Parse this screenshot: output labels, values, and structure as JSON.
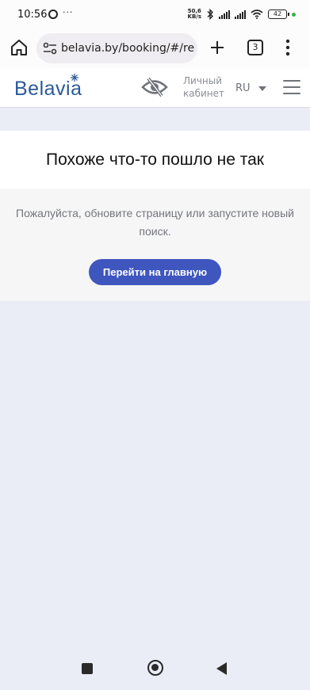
{
  "status_bar": {
    "time": "10:56",
    "notification_dots": "···",
    "net_speed_value": "50,6",
    "net_speed_unit": "KB/s",
    "battery": "42",
    "battery_dot_color": "#35b34a",
    "icons": [
      "record-icon",
      "bluetooth-icon",
      "signal-icon",
      "signal-icon",
      "wifi-icon",
      "battery-icon"
    ]
  },
  "browser": {
    "url": "belavia.by/booking/#/re",
    "tab_count": "3",
    "icons": [
      "home-icon",
      "site-settings-icon",
      "plus-icon",
      "tabs-icon",
      "more-vert-icon"
    ]
  },
  "header": {
    "logo": "Belavia",
    "cabinet_line1": "Личный",
    "cabinet_line2": "кабинет",
    "language": "RU",
    "brand_color": "#2a5a98",
    "icons": [
      "accessibility-eye-icon",
      "caret-down-icon",
      "menu-icon"
    ]
  },
  "error": {
    "title": "Похоже что-то пошло не так",
    "message": "Пожалуйста, обновите страницу или запустите новый поиск.",
    "button_label": "Перейти на главную",
    "button_color": "#3f56bf"
  },
  "nav_bar": {
    "icons": [
      "recents-icon",
      "home-icon",
      "back-icon"
    ]
  }
}
